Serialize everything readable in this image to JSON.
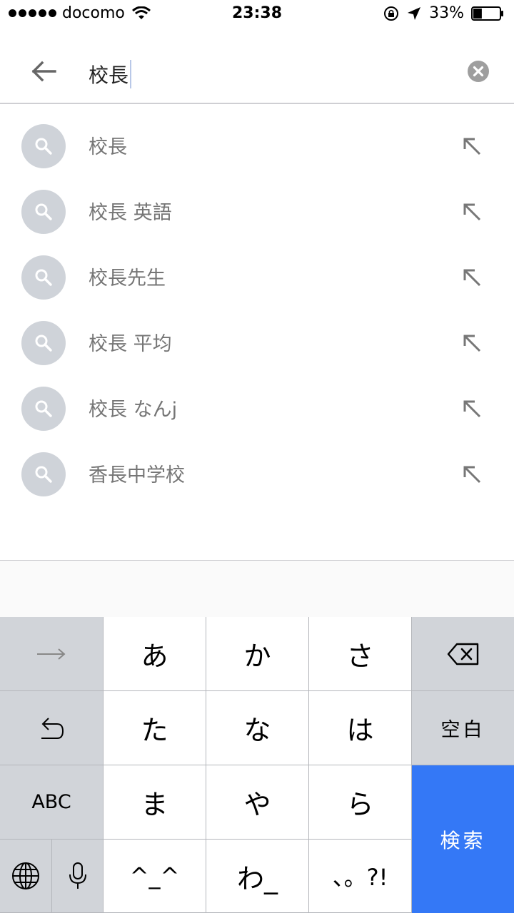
{
  "status_bar": {
    "carrier": "docomo",
    "time": "23:38",
    "battery_percent": "33%",
    "battery_level": 0.33
  },
  "search": {
    "query": "校長"
  },
  "suggestions": [
    {
      "text": "校長"
    },
    {
      "text": "校長 英語"
    },
    {
      "text": "校長先生"
    },
    {
      "text": "校長 平均"
    },
    {
      "text": "校長 なんj"
    },
    {
      "text": "香長中学校"
    }
  ],
  "keyboard": {
    "row1": [
      "あ",
      "か",
      "さ"
    ],
    "row2": [
      "た",
      "な",
      "は"
    ],
    "row3": [
      "ま",
      "や",
      "ら"
    ],
    "row4": [
      "^_^",
      "わ_",
      "、。?!"
    ],
    "space_label": "空白",
    "abc_label": "ABC",
    "search_label": "検索"
  },
  "colors": {
    "accent": "#3478f6",
    "suggestion_circle": "#cfd3d9",
    "key_dark": "#d1d4d9"
  }
}
